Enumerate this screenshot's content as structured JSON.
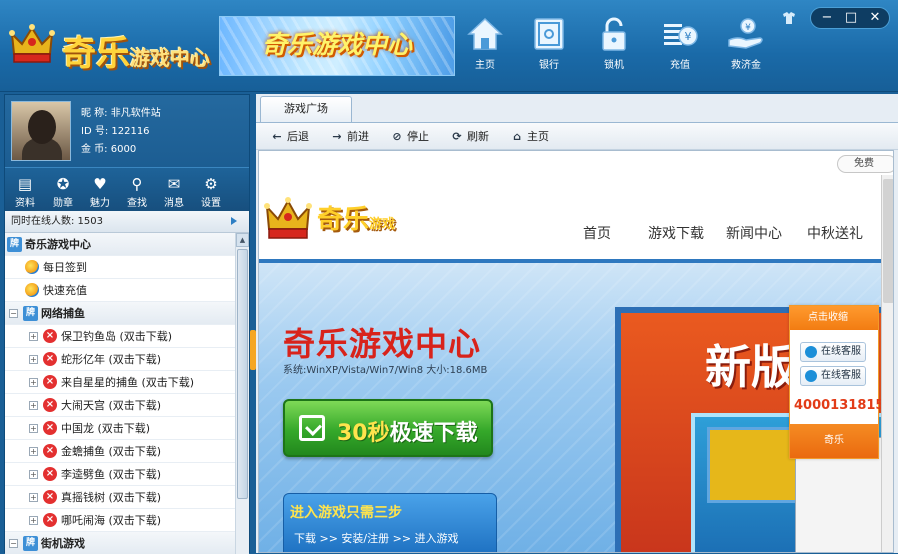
{
  "header": {
    "logo_main": "奇乐",
    "logo_sub": "游戏中心",
    "banner_text": "奇乐游戏中心",
    "nav": [
      {
        "label": "主页",
        "icon": "home-icon"
      },
      {
        "label": "银行",
        "icon": "safe-icon"
      },
      {
        "label": "锁机",
        "icon": "lock-icon"
      },
      {
        "label": "充值",
        "icon": "coins-icon"
      },
      {
        "label": "救济金",
        "icon": "relief-icon"
      }
    ]
  },
  "profile": {
    "nickname": "昵 称: 非凡软件站",
    "id": "ID 号: 122116",
    "coins": "金 币: 6000"
  },
  "tools": [
    "资料",
    "勋章",
    "魅力",
    "查找",
    "消息",
    "设置"
  ],
  "online_text": "同时在线人数: 1503",
  "tree": [
    {
      "type": "group",
      "label": "奇乐游戏中心"
    },
    {
      "type": "item",
      "label": "每日签到"
    },
    {
      "type": "item",
      "label": "快速充值"
    },
    {
      "type": "group",
      "label": "网络捕鱼"
    },
    {
      "type": "game",
      "label": "保卫钓鱼岛 (双击下载)"
    },
    {
      "type": "game",
      "label": "蛇形亿年 (双击下载)"
    },
    {
      "type": "game",
      "label": "来自星星的捕鱼 (双击下载)"
    },
    {
      "type": "game",
      "label": "大闹天宫 (双击下载)"
    },
    {
      "type": "game",
      "label": "中国龙 (双击下载)"
    },
    {
      "type": "game",
      "label": "金蟾捕鱼 (双击下载)"
    },
    {
      "type": "game",
      "label": "李逵劈鱼 (双击下载)"
    },
    {
      "type": "game",
      "label": "真摇钱树 (双击下载)"
    },
    {
      "type": "game",
      "label": "哪吒闹海 (双击下载)"
    },
    {
      "type": "group",
      "label": "街机游戏"
    }
  ],
  "main": {
    "tab": "游戏广场",
    "nav": {
      "back": "后退",
      "forward": "前进",
      "stop": "停止",
      "refresh": "刷新",
      "home": "主页"
    },
    "free_btn": "免费"
  },
  "site": {
    "logo_main": "奇乐",
    "logo_sub": "游戏",
    "menu": [
      "首页",
      "游戏下载",
      "新闻中心",
      "中秋送礼"
    ],
    "hero_title": "奇乐游戏中心",
    "hero_sys": "系统:WinXP/Vista/Win7/Win8 大小:18.6MB",
    "dl_num": "30秒",
    "dl_text": "极速下载",
    "steps_title": "进入游戏只需三步",
    "steps_body": "下载 >> 安装/注册 >> 进入游戏",
    "promo_text": "新版",
    "float_head": "点击收缩",
    "float_kf1": "在线客服",
    "float_kf2": "在线客服",
    "float_phone": "4000131815",
    "float_foot": "奇乐"
  },
  "colors": {
    "accent": "#1a6aa8",
    "brand_gold": "#ffd43b",
    "download_green": "#35a82a",
    "title_red": "#d8231b"
  }
}
